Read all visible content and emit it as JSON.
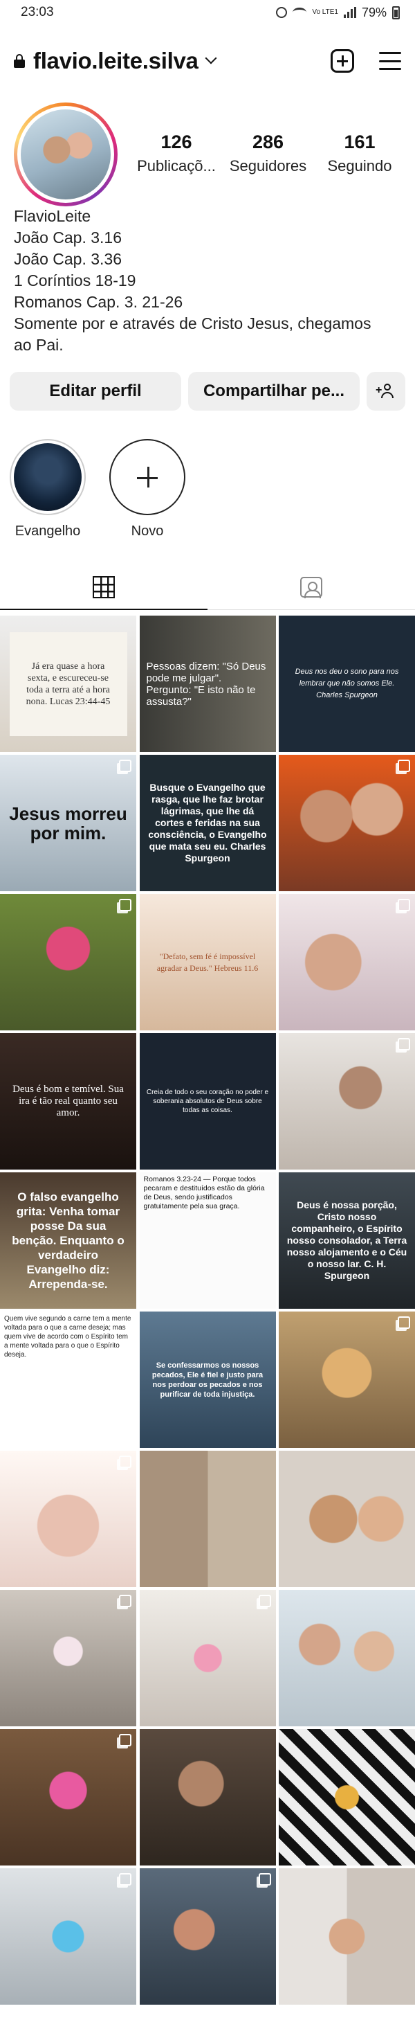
{
  "status_bar": {
    "time": "23:03",
    "network": "Vo LTE1",
    "battery": "79%"
  },
  "header": {
    "username": "flavio.leite.silva",
    "icons": [
      "lock-icon",
      "chevron-down-icon",
      "new-post-icon",
      "menu-icon"
    ]
  },
  "profile": {
    "stats": [
      {
        "value": "126",
        "label": "Publicaçõ..."
      },
      {
        "value": "286",
        "label": "Seguidores"
      },
      {
        "value": "161",
        "label": "Seguindo"
      }
    ],
    "name": "FlavioLeite",
    "bio_lines": [
      "João Cap. 3.16",
      "João Cap. 3.36",
      "1 Coríntios 18-19",
      "Romanos Cap. 3. 21-26",
      "Somente por e através de Cristo Jesus, chegamos",
      "ao Pai."
    ]
  },
  "buttons": {
    "edit": "Editar perfil",
    "share": "Compartilhar pe..."
  },
  "highlights": [
    {
      "label": "Evangelho"
    },
    {
      "label": "Novo"
    }
  ],
  "tabs": [
    "grid-icon",
    "tagged-icon"
  ],
  "posts": [
    {
      "caption": "Já era quase a hora sexta, e escureceu-se toda a terra até a hora nona. Lucas 23:44-45"
    },
    {
      "caption": "Pessoas dizem: \"Só Deus pode me julgar\". Pergunto: \"E isto não te assusta?\""
    },
    {
      "caption": "Deus nos deu o sono para nos lembrar que não somos Ele. Charles Spurgeon"
    },
    {
      "caption": "Jesus morreu por mim."
    },
    {
      "caption": "Busque o Evangelho que rasga, que lhe faz brotar lágrimas, que lhe dá cortes e feridas na sua consciência, o Evangelho que mata seu eu. Charles Spurgeon"
    },
    {
      "caption": ""
    },
    {
      "caption": ""
    },
    {
      "caption": "\"Defato, sem fé é impossível agradar a Deus.\" Hebreus 11.6"
    },
    {
      "caption": ""
    },
    {
      "caption": "Deus é bom e temível. Sua ira é tão real quanto seu amor."
    },
    {
      "caption": "Creia de todo o seu coração no poder e soberania absolutos de Deus sobre todas as coisas."
    },
    {
      "caption": ""
    },
    {
      "caption": "O falso evangelho grita: Venha tomar posse Da sua benção. Enquanto o verdadeiro Evangelho diz: Arrependa-se."
    },
    {
      "caption": "Romanos 3.23-24 — Porque todos pecaram e destituídos estão da glória de Deus, sendo justificados gratuitamente pela sua graça."
    },
    {
      "caption": "Deus é nossa porção, Cristo nosso companheiro, o Espírito nosso consolador, a Terra nosso alojamento e o Céu o nosso lar. C. H. Spurgeon"
    },
    {
      "caption": "Quem vive segundo a carne tem a mente voltada para o que a carne deseja; mas quem vive de acordo com o Espírito tem a mente voltada para o que o Espírito deseja."
    },
    {
      "caption": "Se confessarmos os nossos pecados, Ele é fiel e justo para nos perdoar os pecados e nos purificar de toda injustiça."
    },
    {
      "caption": ""
    },
    {
      "caption": ""
    },
    {
      "caption": ""
    },
    {
      "caption": ""
    },
    {
      "caption": ""
    },
    {
      "caption": ""
    },
    {
      "caption": ""
    },
    {
      "caption": ""
    },
    {
      "caption": ""
    },
    {
      "caption": ""
    },
    {
      "caption": ""
    },
    {
      "caption": ""
    },
    {
      "caption": ""
    }
  ]
}
